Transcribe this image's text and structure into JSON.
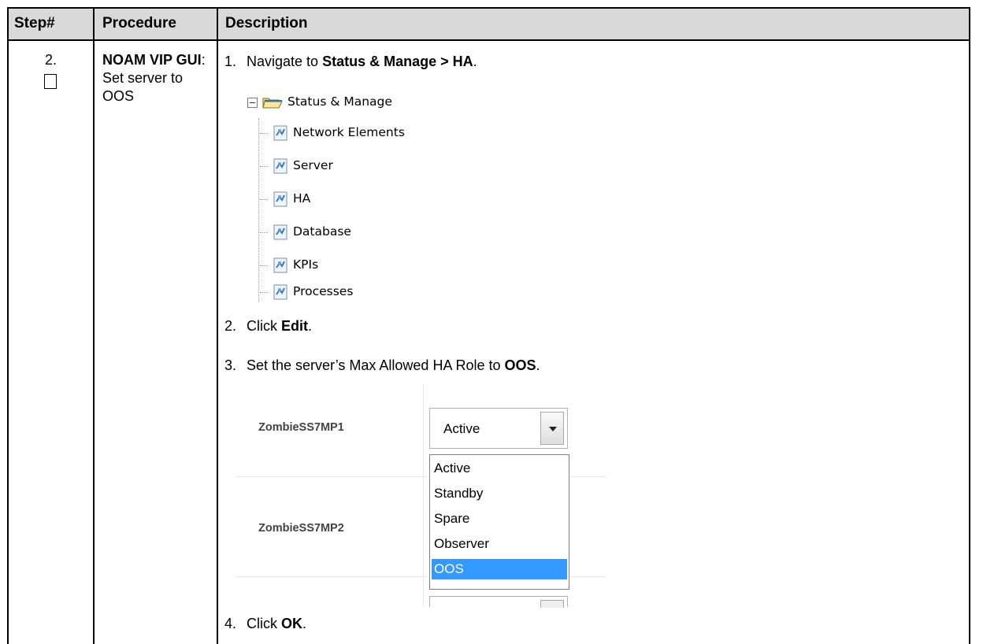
{
  "header": {
    "col_step": "Step#",
    "col_procedure": "Procedure",
    "col_description": "Description"
  },
  "row": {
    "step_number": "2.",
    "procedure_bold": "NOAM VIP GUI",
    "procedure_rest": ": Set server to OOS",
    "steps": [
      {
        "num": "1.",
        "pre": "Navigate to ",
        "bold": "Status & Manage > HA",
        "post": "."
      },
      {
        "num": "2.",
        "pre": "Click ",
        "bold": "Edit",
        "post": "."
      },
      {
        "num": "3.",
        "pre": "Set the server’s Max Allowed HA Role to ",
        "bold": "OOS",
        "post": "."
      },
      {
        "num": "4.",
        "pre": "Click ",
        "bold": "OK",
        "post": "."
      }
    ]
  },
  "tree": {
    "root": "Status & Manage",
    "items": [
      "Network Elements",
      "Server",
      "HA",
      "Database",
      "KPIs",
      "Processes"
    ]
  },
  "ha_screenshot": {
    "server1": "ZombieSS7MP1",
    "server2": "ZombieSS7MP2",
    "selected_value": "Active",
    "options": [
      "Active",
      "Standby",
      "Spare",
      "Observer",
      "OOS"
    ],
    "highlighted_option": "OOS",
    "highlight_color": "#3399ff"
  }
}
